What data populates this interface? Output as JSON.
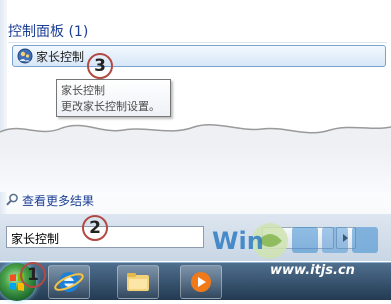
{
  "start_menu": {
    "section_title": "控制面板 (1)",
    "result_item": {
      "label": "家长控制",
      "icon": "parental-controls-icon"
    },
    "tooltip": {
      "title": "家长控制",
      "description": "更改家长控制设置。"
    },
    "see_more": {
      "label": "查看更多结果",
      "icon": "search-icon"
    },
    "search_box": {
      "value": "家长控制"
    }
  },
  "callouts": [
    "1",
    "2",
    "3"
  ],
  "watermark": {
    "brand": "Win7之家",
    "url": "www.itjs.cn"
  },
  "colors": {
    "link_blue": "#1c3f95",
    "callout_red": "#b24a44",
    "highlight_border": "#7da2ce"
  }
}
